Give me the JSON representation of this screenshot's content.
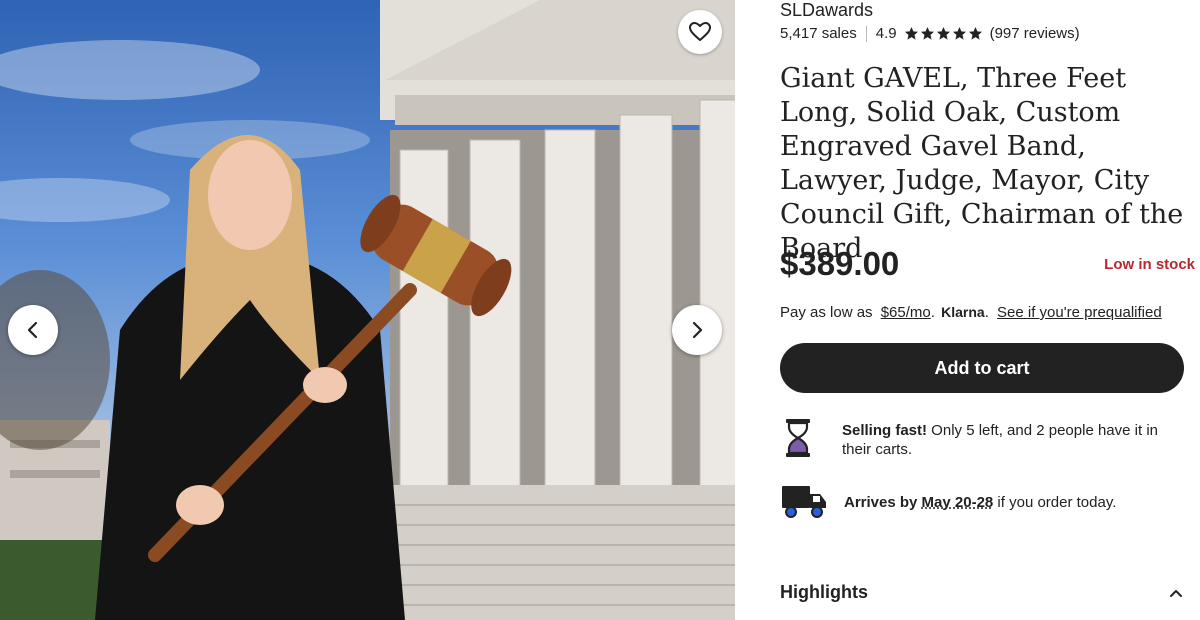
{
  "gallery": {
    "prev_icon": "chevron-left-icon",
    "next_icon": "chevron-right-icon",
    "favorite_icon": "heart-outline-icon"
  },
  "shop": {
    "name": "SLDawards",
    "sales": "5,417 sales",
    "rating": "4.9",
    "stars": 5,
    "reviews": "(997 reviews)"
  },
  "product": {
    "title": "Giant GAVEL, Three Feet Long, Solid Oak, Custom Engraved Gavel Band, Lawyer, Judge, Mayor, City Council Gift, Chairman of the Board",
    "price": "$389.00",
    "stock": "Low in stock"
  },
  "klarna": {
    "prefix": "Pay as low as",
    "amount": "$65/mo",
    "dot": ".",
    "brand": "Klarna",
    "brand_dot": ".",
    "link": "See if you're prequalified"
  },
  "cart": {
    "label": "Add to cart"
  },
  "selling_fast": {
    "icon": "hourglass-icon",
    "bold": "Selling fast!",
    "text": " Only 5 left, and 2 people have it in their carts."
  },
  "arrives": {
    "icon": "delivery-truck-icon",
    "bold": "Arrives by",
    "date": "May 20-28",
    "text": " if you order today."
  },
  "highlights": {
    "label": "Highlights",
    "icon": "chevron-up-icon"
  },
  "colors": {
    "accent": "#222222",
    "stock": "#b8282d",
    "hourglass": "#7b5ea7"
  }
}
